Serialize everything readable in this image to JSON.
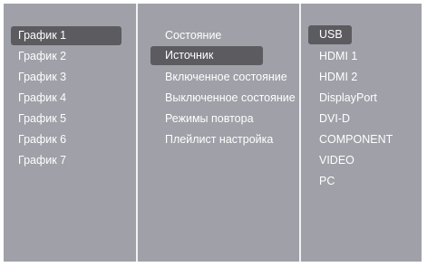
{
  "menu": {
    "schedules": [
      {
        "label": "График 1",
        "selected": true
      },
      {
        "label": "График 2",
        "selected": false
      },
      {
        "label": "График 3",
        "selected": false
      },
      {
        "label": "График 4",
        "selected": false
      },
      {
        "label": "График 5",
        "selected": false
      },
      {
        "label": "График 6",
        "selected": false
      },
      {
        "label": "График 7",
        "selected": false
      }
    ],
    "settings": [
      {
        "label": "Состояние",
        "selected": false
      },
      {
        "label": "Источник",
        "selected": true
      },
      {
        "label": "Включенное состояние",
        "selected": false
      },
      {
        "label": "Выключенное состояние",
        "selected": false
      },
      {
        "label": "Режимы повтора",
        "selected": false
      },
      {
        "label": "Плейлист настройка",
        "selected": false
      }
    ],
    "sources": [
      {
        "label": "USB",
        "selected": true
      },
      {
        "label": "HDMI 1",
        "selected": false
      },
      {
        "label": "HDMI 2",
        "selected": false
      },
      {
        "label": "DisplayPort",
        "selected": false
      },
      {
        "label": "DVI-D",
        "selected": false
      },
      {
        "label": "COMPONENT",
        "selected": false
      },
      {
        "label": "VIDEO",
        "selected": false
      },
      {
        "label": "PC",
        "selected": false
      }
    ]
  },
  "colors": {
    "panel_background": "#9fa0a8",
    "selection_highlight": "#5b5b60",
    "divider": "#f2f2f4",
    "text": "#ffffff"
  }
}
